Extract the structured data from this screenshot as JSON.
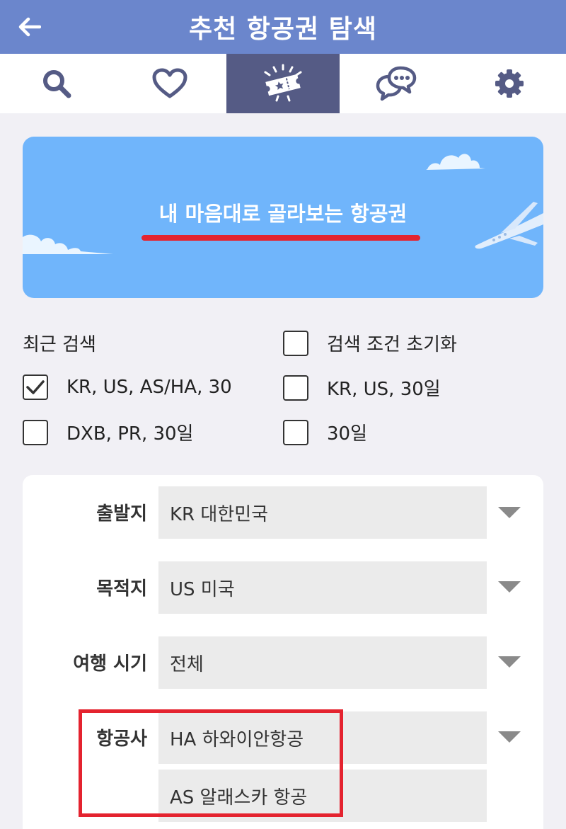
{
  "header": {
    "title": "추천 항공권 탐색",
    "back_icon": "arrow-left-icon"
  },
  "tabs": [
    {
      "name": "search",
      "icon": "search-icon",
      "active": false
    },
    {
      "name": "favorites",
      "icon": "heart-icon",
      "active": false
    },
    {
      "name": "tickets",
      "icon": "ticket-icon",
      "active": true
    },
    {
      "name": "chat",
      "icon": "chat-icon",
      "active": false
    },
    {
      "name": "settings",
      "icon": "gear-icon",
      "active": false
    }
  ],
  "banner": {
    "text": "내 마음대로 골라보는 항공권"
  },
  "recent": {
    "title": "최근 검색",
    "reset_label": "검색 조건 초기화",
    "items": [
      {
        "label": "KR, US, AS/HA, 30",
        "checked": true
      },
      {
        "label": "KR, US, 30일",
        "checked": false
      },
      {
        "label": "DXB, PR, 30일",
        "checked": false
      },
      {
        "label": "30일",
        "checked": false
      }
    ]
  },
  "form": {
    "origin_label": "출발지",
    "origin_value": "KR 대한민국",
    "destination_label": "목적지",
    "destination_value": "US 미국",
    "period_label": "여행 시기",
    "period_value": "전체",
    "airline_label": "항공사",
    "airlines": [
      "HA 하와이안항공",
      "AS 알래스카 항공"
    ]
  },
  "colors": {
    "header": "#6b86cc",
    "active_tab": "#555b85",
    "banner": "#70b5fb",
    "highlight": "#e4232f"
  }
}
